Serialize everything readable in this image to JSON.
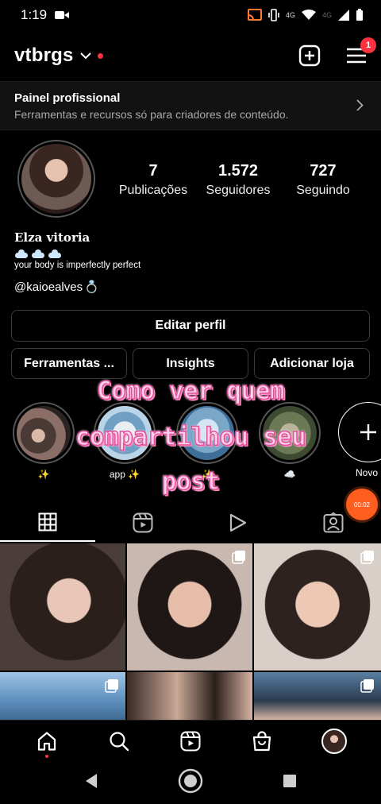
{
  "status_bar": {
    "time": "1:19",
    "network_1": "4G",
    "network_2": "4G"
  },
  "header": {
    "username": "vtbrgs",
    "notification_count": "1"
  },
  "pro_panel": {
    "title": "Painel profissional",
    "subtitle": "Ferramentas e recursos só para criadores de conteúdo."
  },
  "profile": {
    "stats": [
      {
        "value": "7",
        "label": "Publicações"
      },
      {
        "value": "1.572",
        "label": "Seguidores"
      },
      {
        "value": "727",
        "label": "Seguindo"
      }
    ],
    "name": "Elza vitoria",
    "bio_line": "your body is imperfectly perfect",
    "mention": "@kaioealves",
    "mention_emoji": "💍"
  },
  "buttons": {
    "edit": "Editar perfil",
    "tools": "Ferramentas ...",
    "insights": "Insights",
    "shop": "Adicionar loja"
  },
  "highlights": [
    {
      "label": "✨"
    },
    {
      "label": "app ✨"
    },
    {
      "label": "✨"
    },
    {
      "label": "☁️"
    },
    {
      "label": "Novo"
    }
  ],
  "overlay": {
    "line1": "Como ver quem",
    "line2": "compartilhou seu",
    "line3": "post"
  },
  "recording": {
    "time": "00:02"
  },
  "colors": {
    "accent_red": "#ff3040",
    "overlay_pink": "#ffd2e9",
    "recording_orange": "#ff5e1f"
  }
}
